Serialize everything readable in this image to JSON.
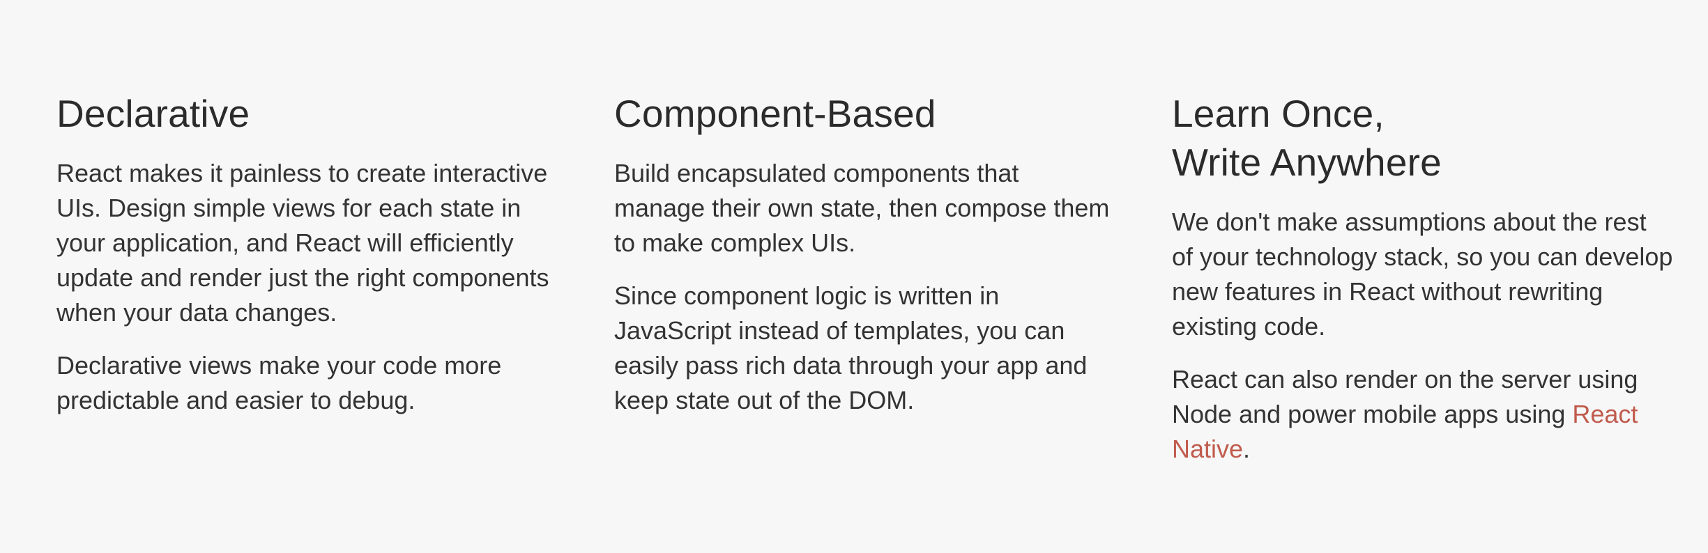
{
  "theme": {
    "background": "#f7f7f7",
    "text": "#333333",
    "heading": "#2b2b2b",
    "link": "#c05b4d"
  },
  "features": [
    {
      "title": "Declarative",
      "paragraphs": [
        "React makes it painless to create interactive UIs. Design simple views for each state in your application, and React will efficiently update and render just the right components when your data changes.",
        "Declarative views make your code more predictable and easier to debug."
      ]
    },
    {
      "title": "Component-Based",
      "paragraphs": [
        "Build encapsulated components that manage their own state, then compose them to make complex UIs.",
        "Since component logic is written in JavaScript instead of templates, you can easily pass rich data through your app and keep state out of the DOM."
      ]
    },
    {
      "title_line1": "Learn Once,",
      "title_line2": "Write Anywhere",
      "paragraphs": [
        "We don't make assumptions about the rest of your technology stack, so you can develop new features in React without rewriting existing code."
      ],
      "last_paragraph": {
        "before_link": "React can also render on the server using Node and power mobile apps using ",
        "link_text": "React Native",
        "after_link": "."
      }
    }
  ]
}
